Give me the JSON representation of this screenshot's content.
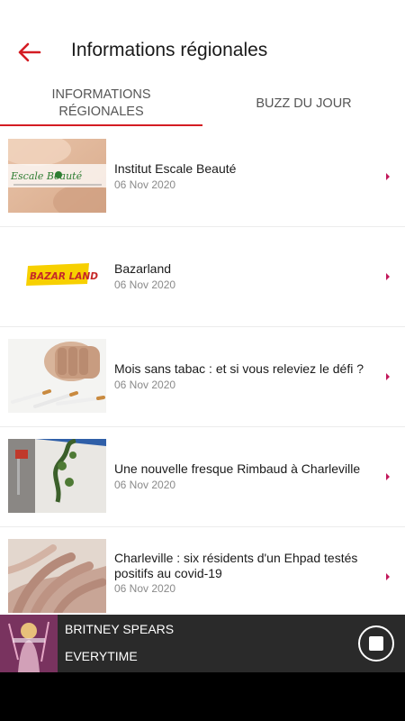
{
  "header": {
    "title": "Informations régionales",
    "back_icon": "arrow-left-icon",
    "accent_color": "#d41c23"
  },
  "tabs": [
    {
      "label": "INFORMATIONS RÉGIONALES",
      "active": true
    },
    {
      "label": "BUZZ DU JOUR",
      "active": false
    }
  ],
  "articles": [
    {
      "title": "Institut Escale Beauté",
      "date": "06 Nov 2020",
      "thumb_text": "Escale Beauté"
    },
    {
      "title": "Bazarland",
      "date": "06 Nov 2020",
      "thumb_text": "BAZAR LAND"
    },
    {
      "title": "Mois sans tabac : et si vous releviez le défi ?",
      "date": "06 Nov 2020"
    },
    {
      "title": "Une nouvelle fresque Rimbaud à Charleville",
      "date": "06 Nov 2020"
    },
    {
      "title": "Charleville : six résidents d'un Ehpad testés positifs au covid-19",
      "date": "06 Nov 2020"
    }
  ],
  "player": {
    "artist": "BRITNEY SPEARS",
    "track": "EVERYTIME",
    "stop_icon": "stop-icon"
  },
  "chevron_color": "#c2185b"
}
